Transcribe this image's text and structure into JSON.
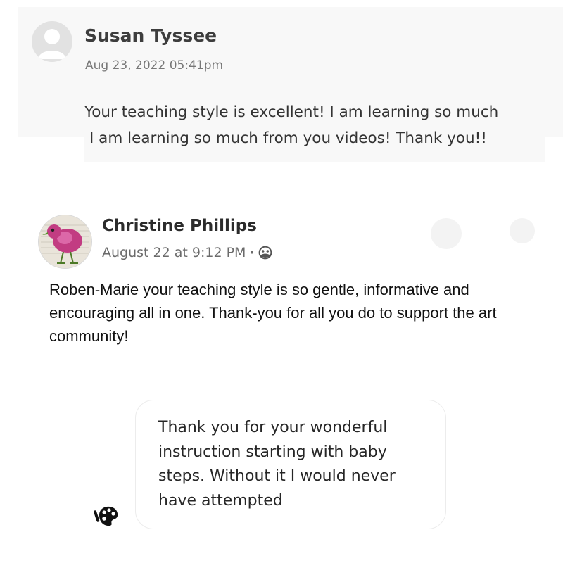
{
  "reviews": [
    {
      "author": "Susan Tyssee",
      "timestamp": "Aug 23, 2022 05:41pm",
      "text_lines": [
        "Your teaching style is excellent!  I am learning so much",
        "I am learning so much from you videos! Thank you!!"
      ],
      "avatar": "default-user-avatar-icon"
    },
    {
      "author": "Christine Phillips",
      "timestamp": "August 22 at 9:12 PM",
      "separator": "·",
      "audience_icon": "friends-audience-icon",
      "text": "Roben-Marie your teaching style is so gentle, informative and encouraging all in one. Thank-you for all you do to support the art community!",
      "avatar": "pink-bird-art-avatar"
    },
    {
      "text": "Thank you for your wonderful instruction starting with baby steps. Without it I would never have attempted",
      "avatar": "art-palette-avatar-icon"
    }
  ]
}
